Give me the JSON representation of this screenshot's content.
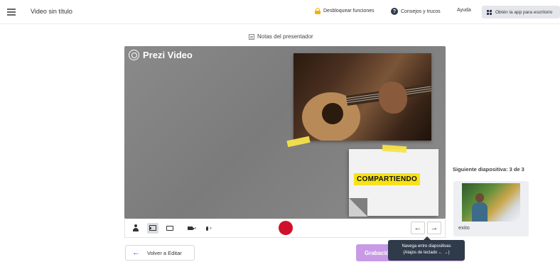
{
  "header": {
    "doc_title": "Video sin título",
    "unlock_label": "Desbloquear funciones",
    "tips_label": "Consejos y trucos",
    "help_label": "Ayuda",
    "app_label": "Obtén la app para escritorio"
  },
  "notes": {
    "label": "Notas del presentador"
  },
  "canvas": {
    "logo_text": "Prezi Video",
    "sticky_text": "COMPARTIENDO"
  },
  "controls": {
    "prev_arrow": "←",
    "next_arrow": "→",
    "caret": "▾"
  },
  "next_slide": {
    "title": "Siguiente diapositiva: 3 de 3",
    "label": "exito"
  },
  "bottom": {
    "back_label": "Volver a Editar",
    "back_arrow": "←",
    "record_label": "Grabación"
  },
  "tooltip": {
    "line1": "Navega entre diapositivas",
    "line2": "(Atajos de teclado ← →)"
  },
  "colors": {
    "record": "#d0102a",
    "accent_purple": "#c89ae6",
    "sticky_yellow": "#f7e218",
    "tooltip_bg": "#2f3a4a"
  }
}
